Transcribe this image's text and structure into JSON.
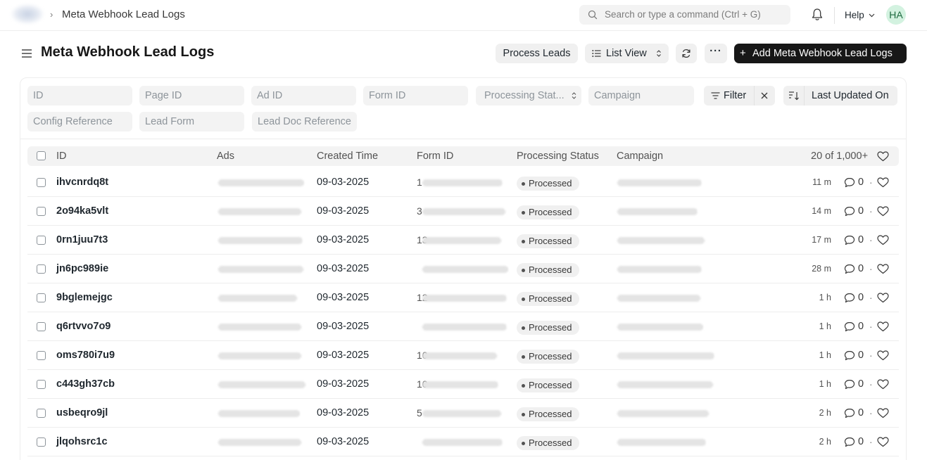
{
  "navbar": {
    "breadcrumb_sep": "›",
    "breadcrumb": "Meta Webhook Lead Logs",
    "search_placeholder": "Search or type a command (Ctrl + G)",
    "help": "Help",
    "avatar_initials": "HA"
  },
  "header": {
    "title": "Meta Webhook Lead Logs",
    "process_leads": "Process Leads",
    "list_view": "List View",
    "more": "···",
    "add_plus": "+",
    "add_label": "Add Meta Webhook Lead Logs"
  },
  "filters": {
    "fields": [
      "ID",
      "Page ID",
      "Ad ID",
      "Form ID",
      "Processing Stat...",
      "Campaign",
      "Config Reference",
      "Lead Form",
      "Lead Doc Reference"
    ],
    "filter_label": "Filter",
    "sort_label": "Last Updated On"
  },
  "table": {
    "columns": {
      "id": "ID",
      "ads": "Ads",
      "created_time": "Created Time",
      "form_id": "Form ID",
      "processing_status": "Processing Status",
      "campaign": "Campaign"
    },
    "count": "20 of 1,000+",
    "rows": [
      {
        "id": "ihvcnrdq8t",
        "created": "09-03-2025",
        "form_prefix": "1",
        "status": "Processed",
        "time": "11 m",
        "comments": "0"
      },
      {
        "id": "2o94ka5vlt",
        "created": "09-03-2025",
        "form_prefix": "3",
        "status": "Processed",
        "time": "14 m",
        "comments": "0"
      },
      {
        "id": "0rn1juu7t3",
        "created": "09-03-2025",
        "form_prefix": "13",
        "status": "Processed",
        "time": "17 m",
        "comments": "0"
      },
      {
        "id": "jn6pc989ie",
        "created": "09-03-2025",
        "form_prefix": "",
        "status": "Processed",
        "time": "28 m",
        "comments": "0"
      },
      {
        "id": "9bglemejgc",
        "created": "09-03-2025",
        "form_prefix": "12",
        "status": "Processed",
        "time": "1 h",
        "comments": "0"
      },
      {
        "id": "q6rtvvo7o9",
        "created": "09-03-2025",
        "form_prefix": "",
        "status": "Processed",
        "time": "1 h",
        "comments": "0"
      },
      {
        "id": "oms780i7u9",
        "created": "09-03-2025",
        "form_prefix": "10",
        "status": "Processed",
        "time": "1 h",
        "comments": "0"
      },
      {
        "id": "c443gh37cb",
        "created": "09-03-2025",
        "form_prefix": "10",
        "status": "Processed",
        "time": "1 h",
        "comments": "0"
      },
      {
        "id": "usbeqro9jl",
        "created": "09-03-2025",
        "form_prefix": "5",
        "status": "Processed",
        "time": "2 h",
        "comments": "0"
      },
      {
        "id": "jlqohsrc1c",
        "created": "09-03-2025",
        "form_prefix": "",
        "status": "Processed",
        "time": "2 h",
        "comments": "0"
      }
    ]
  },
  "colors": {
    "primary_button": "#171717",
    "avatar_bg": "#d3f2e0",
    "avatar_text": "#1d6b3f"
  }
}
